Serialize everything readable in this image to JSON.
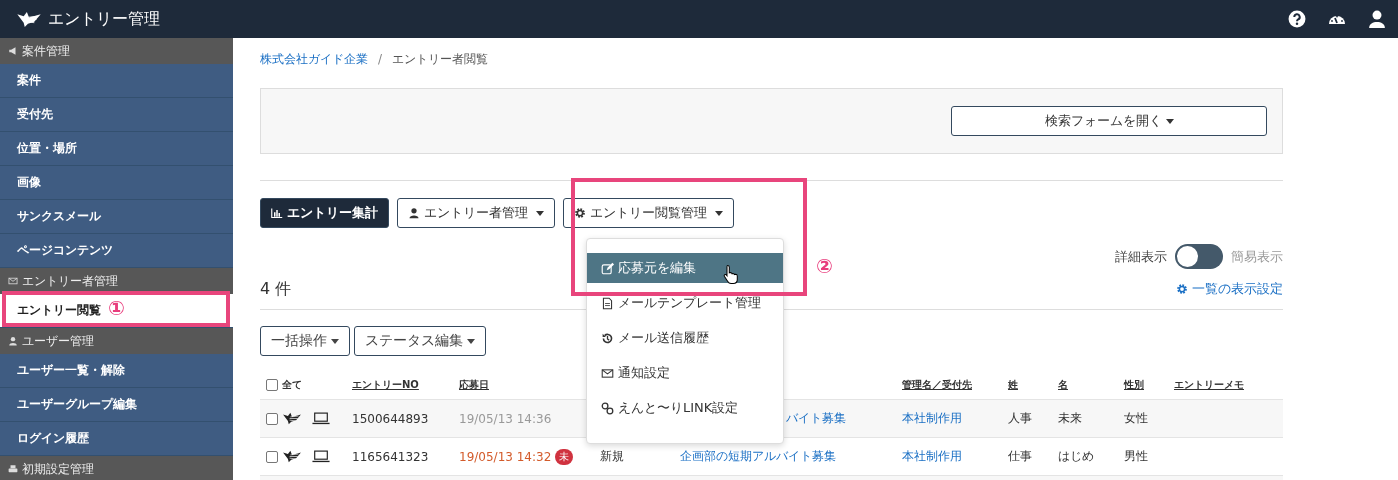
{
  "app": {
    "title": "エントリー管理"
  },
  "sidebar": [
    {
      "heading": "案件管理",
      "items": [
        {
          "label": "案件",
          "selected": false
        },
        {
          "label": "受付先",
          "selected": false
        },
        {
          "label": "位置・場所",
          "selected": false
        },
        {
          "label": "画像",
          "selected": false
        },
        {
          "label": "サンクスメール",
          "selected": false
        },
        {
          "label": "ページコンテンツ",
          "selected": false
        }
      ]
    },
    {
      "heading": "エントリー者管理",
      "items": [
        {
          "label": "エントリー閲覧",
          "selected": true,
          "callout": "①"
        }
      ]
    },
    {
      "heading": "ユーザー管理",
      "items": [
        {
          "label": "ユーザー一覧・解除",
          "selected": false
        },
        {
          "label": "ユーザーグループ編集",
          "selected": false
        },
        {
          "label": "ログイン履歴",
          "selected": false
        }
      ]
    },
    {
      "heading": "初期設定管理"
    }
  ],
  "breadcrumb": {
    "separator": "/",
    "items": [
      {
        "label": "株式会社ガイド企業",
        "link": true
      },
      {
        "label": "エントリー者閲覧",
        "link": false
      }
    ]
  },
  "search_toggle": "検索フォームを開く",
  "toolbar": [
    {
      "label": "エントリー集計",
      "primary": true
    },
    {
      "label": "エントリー者管理",
      "primary": false
    },
    {
      "label": "エントリー閲覧管理",
      "primary": false
    }
  ],
  "dropdown": {
    "callout": "②",
    "items": [
      {
        "label": "応募元を編集",
        "selected": true
      },
      {
        "label": "メールテンプレート管理",
        "selected": false
      },
      {
        "label": "メール送信履歴",
        "selected": false
      },
      {
        "label": "通知設定",
        "selected": false
      },
      {
        "label": "えんと〜りLINK設定",
        "selected": false
      }
    ]
  },
  "view_toggle": {
    "left_label": "詳細表示",
    "right_label": "簡易表示",
    "on": false
  },
  "count": "4 件",
  "list_settings": "一覧の表示設定",
  "bulk_buttons": [
    "一括操作",
    "ステータス編集"
  ],
  "table": {
    "header": {
      "checked": false,
      "select_all": "全て",
      "entry_no": "エントリーNO",
      "date": "応募日",
      "manager": "管理名／受付先",
      "last_name": "姓",
      "first_name": "名",
      "gender": "性別",
      "memo": "エントリーメモ"
    },
    "rows": [
      {
        "checked": false,
        "entry_no": "1500644893",
        "date": "19/05/13 14:36",
        "unread": false,
        "title": "バイト募集",
        "covered": true,
        "manager": "本社制作用",
        "last_name": "人事",
        "first_name": "未来",
        "gender": "女性"
      },
      {
        "checked": false,
        "entry_no": "1165641323",
        "date": "19/05/13 14:32",
        "unread": true,
        "badge": "未",
        "status": "新規",
        "title": "企画部の短期アルバイト募集",
        "covered": false,
        "manager": "本社制作用",
        "last_name": "仕事",
        "first_name": "はじめ",
        "gender": "男性"
      }
    ]
  }
}
